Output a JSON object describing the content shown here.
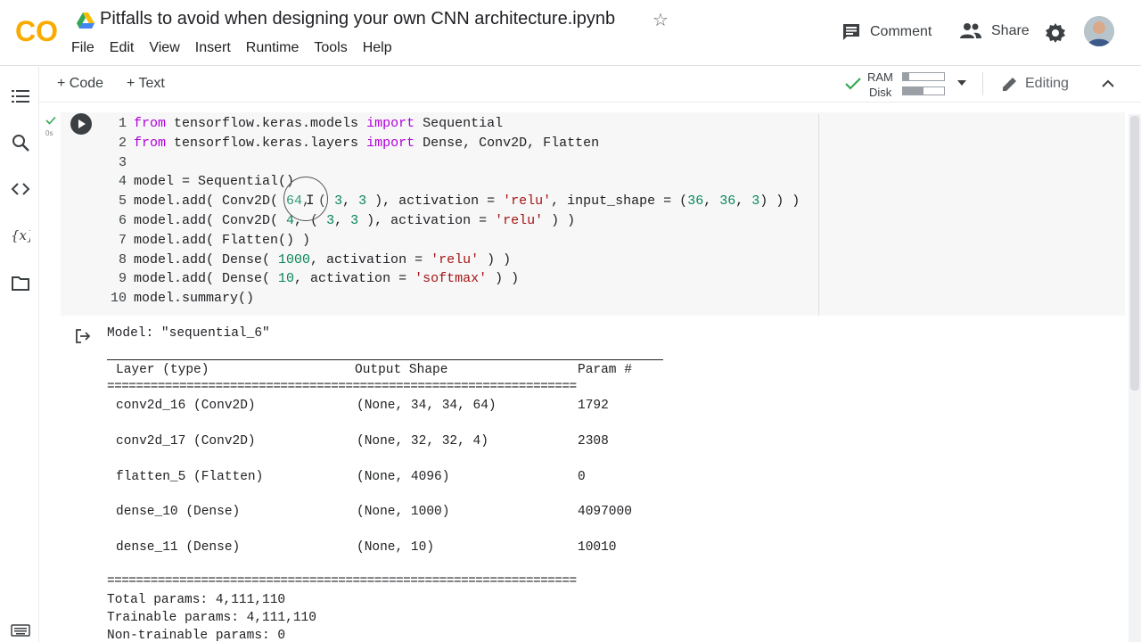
{
  "header": {
    "logo_text": "CO",
    "title": "Pitfalls to avoid when designing your own CNN architecture.ipynb",
    "menu": [
      "File",
      "Edit",
      "View",
      "Insert",
      "Runtime",
      "Tools",
      "Help"
    ],
    "comment_label": "Comment",
    "share_label": "Share"
  },
  "toolbar": {
    "add_code_label": "+ Code",
    "add_text_label": "+ Text",
    "ram_label": "RAM",
    "disk_label": "Disk",
    "ram_usage": 0.15,
    "disk_usage": 0.5,
    "editing_label": "Editing"
  },
  "cell": {
    "time": "0s",
    "lines": [
      {
        "n": "1"
      },
      {
        "n": "2"
      },
      {
        "n": "3"
      },
      {
        "n": "4"
      },
      {
        "n": "5"
      },
      {
        "n": "6"
      },
      {
        "n": "7"
      },
      {
        "n": "8"
      },
      {
        "n": "9"
      },
      {
        "n": "10"
      }
    ],
    "code": {
      "l1": {
        "kw1": "from",
        "mod": " tensorflow.keras.models ",
        "kw2": "import",
        "rest": " Sequential"
      },
      "l2": {
        "kw1": "from",
        "mod": " tensorflow.keras.layers ",
        "kw2": "import",
        "rest": " Dense, Conv2D, Flatten"
      },
      "l4": "model = Sequential()",
      "l5": {
        "a": "model.add( Conv2D( ",
        "n1": "64",
        "b": ", ( ",
        "n2": "3",
        "c": ", ",
        "n3": "3",
        "d": " ), activation = ",
        "s": "'relu'",
        "e": ", input_shape = (",
        "n4": "36",
        "f": ", ",
        "n5": "36",
        "g": ", ",
        "n6": "3",
        "h": ") ) )"
      },
      "l6": {
        "a": "model.add( Conv2D( ",
        "n1": "4",
        "b": ", ( ",
        "n2": "3",
        "c": ", ",
        "n3": "3",
        "d": " ), activation = ",
        "s": "'relu'",
        "e": " ) )"
      },
      "l7": "model.add( Flatten() )",
      "l8": {
        "a": "model.add( Dense( ",
        "n1": "1000",
        "b": ", activation = ",
        "s": "'relu'",
        "c": " ) )"
      },
      "l9": {
        "a": "model.add( Dense( ",
        "n1": "10",
        "b": ", activation = ",
        "s": "'softmax'",
        "c": " ) )"
      },
      "l10": "model.summary()"
    }
  },
  "output": {
    "model_line": "Model: \"sequential_6\"",
    "headers": {
      "layer": "Layer (type)",
      "shape": "Output Shape",
      "params": "Param #"
    },
    "separator": "=================================================================",
    "rows": [
      {
        "layer": "conv2d_16 (Conv2D)",
        "shape": "(None, 34, 34, 64)",
        "params": "1792"
      },
      {
        "layer": "conv2d_17 (Conv2D)",
        "shape": "(None, 32, 32, 4)",
        "params": "2308"
      },
      {
        "layer": "flatten_5 (Flatten)",
        "shape": "(None, 4096)",
        "params": "0"
      },
      {
        "layer": "dense_10 (Dense)",
        "shape": "(None, 1000)",
        "params": "4097000"
      },
      {
        "layer": "dense_11 (Dense)",
        "shape": "(None, 10)",
        "params": "10010"
      }
    ],
    "total": "Total params: 4,111,110",
    "trainable": "Trainable params: 4,111,110",
    "non_trainable": "Non-trainable params: 0"
  },
  "colors": {
    "logo_orange": "#F9AB00",
    "logo_dark_orange": "#E8710A",
    "check_green": "#34A853",
    "keyword": "#AF00DB",
    "number": "#098658",
    "string": "#A31515"
  }
}
